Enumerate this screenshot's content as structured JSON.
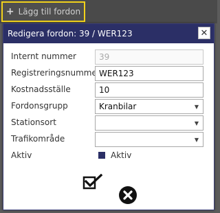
{
  "toolbar": {
    "add_button": {
      "icon": "plus-icon",
      "label": "Lägg till fordon",
      "border_color": "#f2d21b"
    }
  },
  "dialog": {
    "title": "Redigera fordon: 39 / WER123",
    "close_icon": "close-icon",
    "title_bar_color": "#2b2f66",
    "fields": {
      "internt_nummer": {
        "label": "Internt nummer",
        "value": "39",
        "disabled": true
      },
      "registreringsnummer": {
        "label": "Registreringsnummer",
        "value": "WER123"
      },
      "kostnadsstalle": {
        "label": "Kostnadsställe",
        "value": "10"
      },
      "fordonsgrupp": {
        "label": "Fordonsgrupp",
        "value": "Kranbilar"
      },
      "stationsort": {
        "label": "Stationsort",
        "value": ""
      },
      "trafikomrade": {
        "label": "Trafikområde",
        "value": ""
      },
      "aktiv": {
        "label": "Aktiv",
        "checkbox_label": "Aktiv",
        "checked": true
      }
    },
    "actions": {
      "save_icon": "checkbox-check-icon",
      "cancel_icon": "cancel-x-circle-icon"
    }
  }
}
